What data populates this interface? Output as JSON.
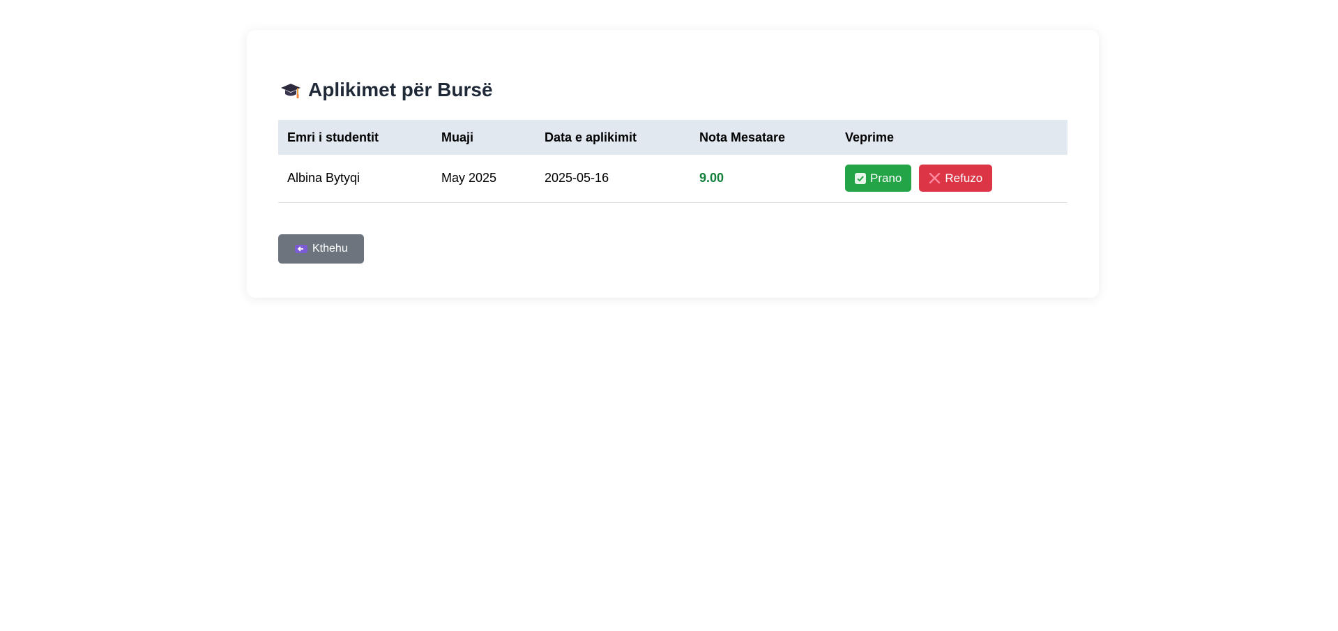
{
  "page": {
    "title": "Aplikimet për Bursë",
    "title_icon": "graduation-cap-icon"
  },
  "table": {
    "headers": {
      "name": "Emri i studentit",
      "month": "Muaji",
      "date": "Data e aplikimit",
      "grade": "Nota Mesatare",
      "actions": "Veprime"
    },
    "rows": [
      {
        "name": "Albina Bytyqi",
        "month": "May 2025",
        "date": "2025-05-16",
        "grade": "9.00",
        "accept_label": "Prano",
        "reject_label": "Refuzo"
      }
    ]
  },
  "back_button": {
    "label": "Kthehu",
    "icon": "back-arrow-icon"
  },
  "colors": {
    "accept": "#22a447",
    "reject": "#dc3545",
    "back": "#6c757d",
    "header_bg": "#e2e8f0",
    "grade": "#15803d"
  }
}
